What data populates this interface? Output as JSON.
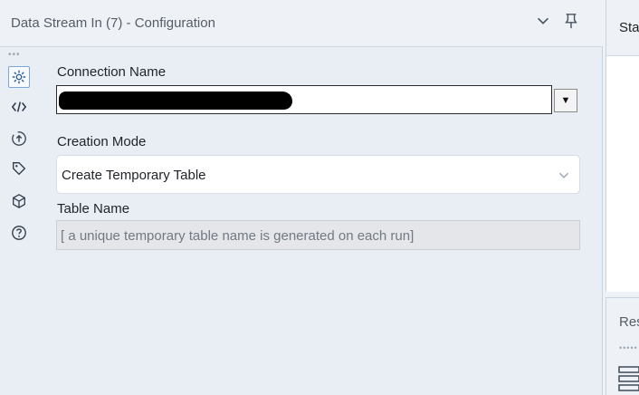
{
  "panel": {
    "title": "Data Stream In (7) - Configuration"
  },
  "rail": {
    "items": [
      {
        "name": "settings",
        "icon": "gear-icon",
        "active": true
      },
      {
        "name": "code",
        "icon": "code-icon",
        "active": false
      },
      {
        "name": "annotation",
        "icon": "circle-arrow-icon",
        "active": false
      },
      {
        "name": "tag",
        "icon": "tag-icon",
        "active": false
      },
      {
        "name": "metadata",
        "icon": "cube-icon",
        "active": false
      },
      {
        "name": "help",
        "icon": "help-icon",
        "active": false
      }
    ]
  },
  "form": {
    "connection_label": "Connection Name",
    "connection_value": "",
    "connection_dropdown_glyph": "▼",
    "creation_mode_label": "Creation Mode",
    "creation_mode_value": "Create Temporary Table",
    "table_name_label": "Table Name",
    "table_name_value": "[ a unique temporary table name is generated on each run]"
  },
  "right": {
    "top_title": "Sta",
    "bottom_title": "Res"
  },
  "colors": {
    "accent": "#7aa7d8",
    "panel_bg": "#e9eef5",
    "text": "#1f2328"
  }
}
